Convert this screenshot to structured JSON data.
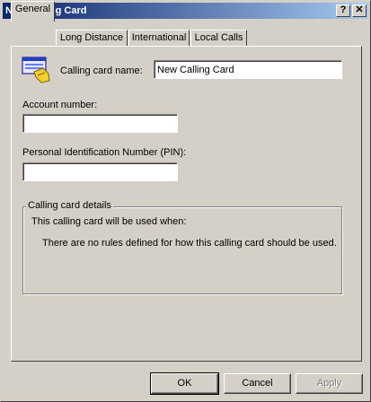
{
  "window": {
    "title": "New Calling Card",
    "help_glyph": "?",
    "close_glyph": "✕"
  },
  "tabs": [
    {
      "label": "General"
    },
    {
      "label": "Long Distance"
    },
    {
      "label": "International"
    },
    {
      "label": "Local Calls"
    }
  ],
  "general": {
    "card_name_label": "Calling card name:",
    "card_name_value": "New Calling Card",
    "account_label": "Account number:",
    "account_value": "",
    "pin_label": "Personal Identification Number (PIN):",
    "pin_value": "",
    "details_legend": "Calling card details",
    "details_intro": "This calling card will be used when:",
    "details_rule": "There are no rules defined for how this calling card should be used."
  },
  "buttons": {
    "ok": "OK",
    "cancel": "Cancel",
    "apply": "Apply"
  },
  "icons": {
    "card": "calling-card-icon"
  }
}
